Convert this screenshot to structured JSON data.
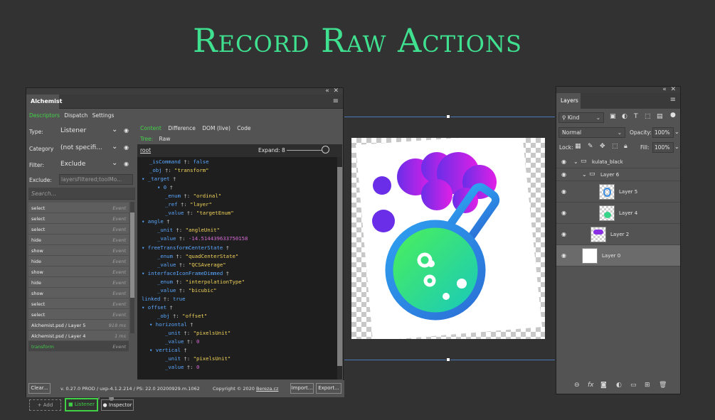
{
  "headline": "Record Raw Actions",
  "alchemist": {
    "title": "Alchemist",
    "nav": [
      "Descriptors",
      "Dispatch",
      "Settings"
    ],
    "filters": {
      "type_label": "Type:",
      "type_value": "Listener",
      "category_label": "Category",
      "category_value": "(not specifi...",
      "filter_label": "Filter:",
      "filter_value": "Exclude",
      "exclude_label": "Exclude:",
      "exclude_value": "layersFiltered;toolMo..."
    },
    "search_placeholder": "Search...",
    "events": [
      {
        "name": "select",
        "type": "Event"
      },
      {
        "name": "select",
        "type": "Event"
      },
      {
        "name": "select",
        "type": "Event"
      },
      {
        "name": "hide",
        "type": "Event"
      },
      {
        "name": "show",
        "type": "Event"
      },
      {
        "name": "hide",
        "type": "Event"
      },
      {
        "name": "show",
        "type": "Event"
      },
      {
        "name": "hide",
        "type": "Event"
      },
      {
        "name": "show",
        "type": "Event"
      },
      {
        "name": "select",
        "type": "Event"
      },
      {
        "name": "select",
        "type": "Event"
      },
      {
        "name": "Alchemist.psd / Layer 5",
        "type": "918 ms"
      },
      {
        "name": "Alchemist.psd / Layer 4",
        "type": "1 ms"
      },
      {
        "name": "transform",
        "type": "Event"
      }
    ],
    "buttons": {
      "add": "+ Add",
      "listener": "■ Listener",
      "inspector": "● Inspector"
    },
    "content_tabs": [
      "Content",
      "Difference",
      "DOM (live)",
      "Code"
    ],
    "tree_label": "Tree:",
    "raw_label": "Raw",
    "root_label": "root",
    "expand_label": "Expand: 8",
    "footer": {
      "clear": "Clear...",
      "version": "v. 0.27.0 PROD / uxp-4.1.2.214 / PS: 22.0 20200929.m.1062",
      "copyright": "Copyright © 2020 ",
      "company": "Bereza.cz",
      "import": "Import...",
      "export": "Export..."
    }
  },
  "code_lines": [
    {
      "indent": 1,
      "arrow": "",
      "key": "_isCommand",
      "value": "false",
      "vtype": "kw"
    },
    {
      "indent": 1,
      "arrow": "",
      "key": "_obj",
      "value": "\"transform\"",
      "vtype": "str"
    },
    {
      "indent": 0,
      "arrow": "▾ ",
      "key": "_target",
      "value": "",
      "vtype": "obj"
    },
    {
      "indent": 2,
      "arrow": "▾ ",
      "key": "0",
      "value": "",
      "vtype": "obj"
    },
    {
      "indent": 3,
      "arrow": "",
      "key": "_enum",
      "value": "\"ordinal\"",
      "vtype": "str"
    },
    {
      "indent": 3,
      "arrow": "",
      "key": "_ref",
      "value": "\"layer\"",
      "vtype": "str"
    },
    {
      "indent": 3,
      "arrow": "",
      "key": "_value",
      "value": "\"targetEnum\"",
      "vtype": "str"
    },
    {
      "indent": 0,
      "arrow": "▾ ",
      "key": "angle",
      "value": "",
      "vtype": "obj"
    },
    {
      "indent": 2,
      "arrow": "",
      "key": "_unit",
      "value": "\"angleUnit\"",
      "vtype": "str"
    },
    {
      "indent": 2,
      "arrow": "",
      "key": "_value",
      "value": "-14.514439633750158",
      "vtype": "num"
    },
    {
      "indent": 0,
      "arrow": "▾ ",
      "key": "freeTransformCenterState",
      "value": "",
      "vtype": "obj"
    },
    {
      "indent": 2,
      "arrow": "",
      "key": "_enum",
      "value": "\"quadCenterState\"",
      "vtype": "str"
    },
    {
      "indent": 2,
      "arrow": "",
      "key": "_value",
      "value": "\"QCSAverage\"",
      "vtype": "str"
    },
    {
      "indent": 0,
      "arrow": "▾ ",
      "key": "interfaceIconFrameDimmed",
      "value": "",
      "vtype": "obj"
    },
    {
      "indent": 2,
      "arrow": "",
      "key": "_enum",
      "value": "\"interpolationType\"",
      "vtype": "str"
    },
    {
      "indent": 2,
      "arrow": "",
      "key": "_value",
      "value": "\"bicubic\"",
      "vtype": "str"
    },
    {
      "indent": 0,
      "arrow": "",
      "key": "linked",
      "value": "true",
      "vtype": "kw"
    },
    {
      "indent": 0,
      "arrow": "▾ ",
      "key": "offset",
      "value": "",
      "vtype": "obj"
    },
    {
      "indent": 2,
      "arrow": "",
      "key": "_obj",
      "value": "\"offset\"",
      "vtype": "str"
    },
    {
      "indent": 1,
      "arrow": "▾ ",
      "key": "horizontal",
      "value": "",
      "vtype": "obj"
    },
    {
      "indent": 3,
      "arrow": "",
      "key": "_unit",
      "value": "\"pixelsUnit\"",
      "vtype": "str"
    },
    {
      "indent": 3,
      "arrow": "",
      "key": "_value",
      "value": "0",
      "vtype": "num"
    },
    {
      "indent": 1,
      "arrow": "▾ ",
      "key": "vertical",
      "value": "",
      "vtype": "obj"
    },
    {
      "indent": 3,
      "arrow": "",
      "key": "_unit",
      "value": "\"pixelsUnit\"",
      "vtype": "str"
    },
    {
      "indent": 3,
      "arrow": "",
      "key": "_value",
      "value": "0",
      "vtype": "num"
    }
  ],
  "layers": {
    "title": "Layers",
    "kind_label": "Kind",
    "blend_mode": "Normal",
    "opacity_label": "Opacity:",
    "opacity_value": "100%",
    "lock_label": "Lock:",
    "fill_label": "Fill:",
    "fill_value": "100%",
    "items": [
      {
        "name": "kulata_black",
        "kind": "group",
        "level": 0
      },
      {
        "name": "Layer 6",
        "kind": "group",
        "level": 1
      },
      {
        "name": "Layer 5",
        "kind": "layer",
        "level": 2
      },
      {
        "name": "Layer 4",
        "kind": "layer",
        "level": 2
      },
      {
        "name": "Layer 2",
        "kind": "layer",
        "level": 1
      },
      {
        "name": "Layer 0",
        "kind": "layer",
        "level": 0
      }
    ]
  },
  "colors": {
    "accent_green": "#3fe08f",
    "listener_green": "#3fd045",
    "key_blue": "#5aa7ff",
    "string_yellow": "#f2d45a",
    "number_magenta": "#d46ad4"
  }
}
